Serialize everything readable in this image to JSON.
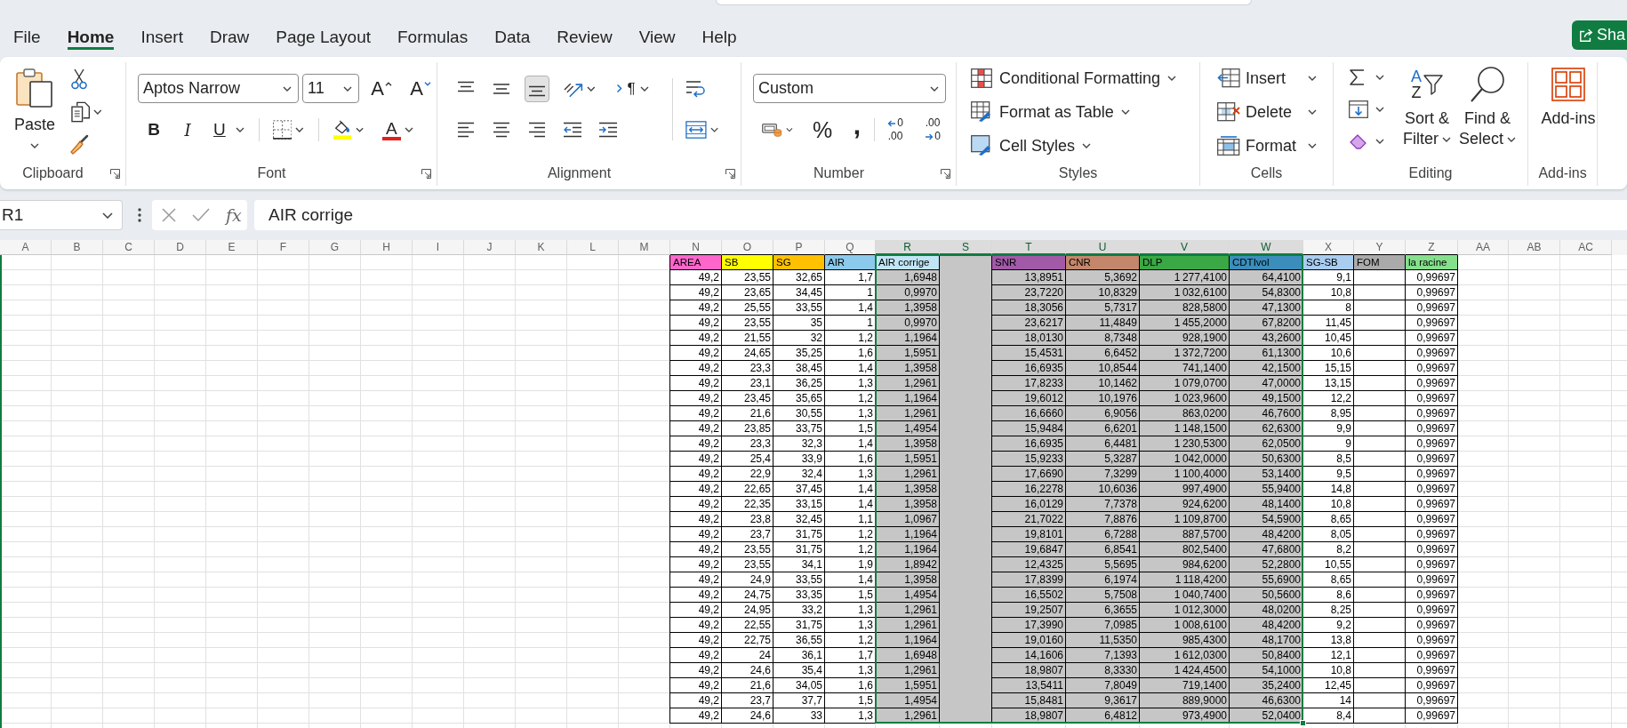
{
  "menu_tabs": [
    {
      "label": "File",
      "selected": false
    },
    {
      "label": "Home",
      "selected": true
    },
    {
      "label": "Insert",
      "selected": false
    },
    {
      "label": "Draw",
      "selected": false
    },
    {
      "label": "Page Layout",
      "selected": false
    },
    {
      "label": "Formulas",
      "selected": false
    },
    {
      "label": "Data",
      "selected": false
    },
    {
      "label": "Review",
      "selected": false
    },
    {
      "label": "View",
      "selected": false
    },
    {
      "label": "Help",
      "selected": false
    }
  ],
  "share_button": {
    "label": "Sha"
  },
  "ribbon": {
    "clipboard": {
      "paste_label": "Paste",
      "group_label": "Clipboard"
    },
    "font": {
      "font_name": "Aptos Narrow",
      "font_size": "11",
      "grow_label": "A",
      "shrink_label": "A",
      "bold_label": "B",
      "italic_label": "I",
      "underline_label": "U",
      "font_color_label": "A",
      "group_label": "Font"
    },
    "alignment": {
      "vertical_align": [
        {
          "kind": "top",
          "selected": false
        },
        {
          "kind": "middle",
          "selected": false
        },
        {
          "kind": "bottom",
          "selected": true
        }
      ],
      "text_direction_label": "¶",
      "group_label": "Alignment"
    },
    "number": {
      "format": "Custom",
      "percent_label": "%",
      "comma_label": ",",
      "increase_decimal": [
        "0",
        ".00"
      ],
      "decrease_decimal": [
        ".00",
        "0"
      ],
      "group_label": "Number"
    },
    "styles": {
      "items": [
        {
          "label": "Conditional Formatting",
          "kind": "conditional"
        },
        {
          "label": "Format as Table",
          "kind": "table"
        },
        {
          "label": "Cell Styles",
          "kind": "styles"
        }
      ],
      "group_label": "Styles"
    },
    "cells": {
      "items": [
        {
          "label": "Insert",
          "kind": "insert"
        },
        {
          "label": "Delete",
          "kind": "delete"
        },
        {
          "label": "Format",
          "kind": "format"
        }
      ],
      "group_label": "Cells"
    },
    "editing": {
      "sort_letters": [
        "A",
        "Z"
      ],
      "sort_label": "Sort & Filter",
      "find_label": "Find & Select",
      "group_label": "Editing"
    },
    "add_ins": {
      "button_label": "Add-ins",
      "group_label": "Add-ins"
    }
  },
  "formula_bar": {
    "name_box": "R1",
    "fx_label": "fx",
    "content": "AIR corrige"
  },
  "sheet": {
    "columns": [
      {
        "letter": "A",
        "selected": false
      },
      {
        "letter": "B",
        "selected": false
      },
      {
        "letter": "C",
        "selected": false
      },
      {
        "letter": "D",
        "selected": false
      },
      {
        "letter": "E",
        "selected": false
      },
      {
        "letter": "F",
        "selected": false
      },
      {
        "letter": "G",
        "selected": false
      },
      {
        "letter": "H",
        "selected": false
      },
      {
        "letter": "I",
        "selected": false
      },
      {
        "letter": "J",
        "selected": false
      },
      {
        "letter": "K",
        "selected": false
      },
      {
        "letter": "L",
        "selected": false
      },
      {
        "letter": "M",
        "selected": false
      },
      {
        "letter": "N",
        "selected": false,
        "header": {
          "label": "AREA",
          "color": "#ff66cc"
        },
        "cells": [
          "49,2",
          "49,2",
          "49,2",
          "49,2",
          "49,2",
          "49,2",
          "49,2",
          "49,2",
          "49,2",
          "49,2",
          "49,2",
          "49,2",
          "49,2",
          "49,2",
          "49,2",
          "49,2",
          "49,2",
          "49,2",
          "49,2",
          "49,2",
          "49,2",
          "49,2",
          "49,2",
          "49,2",
          "49,2",
          "49,2",
          "49,2",
          "49,2",
          "49,2",
          "49,2"
        ]
      },
      {
        "letter": "O",
        "selected": false,
        "header": {
          "label": "SB",
          "color": "#ffff00"
        },
        "cells": [
          "23,55",
          "23,65",
          "25,55",
          "23,55",
          "21,55",
          "24,65",
          "23,3",
          "23,1",
          "23,45",
          "21,6",
          "23,85",
          "23,3",
          "25,4",
          "22,9",
          "22,65",
          "22,35",
          "23,8",
          "23,7",
          "23,55",
          "23,55",
          "24,9",
          "24,75",
          "24,95",
          "22,55",
          "22,75",
          "24",
          "24,6",
          "21,6",
          "23,7",
          "24,6"
        ]
      },
      {
        "letter": "P",
        "selected": false,
        "header": {
          "label": "SG",
          "color": "#ffc000"
        },
        "cells": [
          "32,65",
          "34,45",
          "33,55",
          "35",
          "32",
          "35,25",
          "38,45",
          "36,25",
          "35,65",
          "30,55",
          "33,75",
          "32,3",
          "33,9",
          "32,4",
          "37,45",
          "33,15",
          "32,45",
          "31,75",
          "31,75",
          "34,1",
          "33,55",
          "33,35",
          "33,2",
          "31,75",
          "36,55",
          "36,1",
          "35,4",
          "34,05",
          "37,7",
          "33"
        ]
      },
      {
        "letter": "Q",
        "selected": false,
        "header": {
          "label": "AIR",
          "color": "#8ccaec"
        },
        "cells": [
          "1,7",
          "1",
          "1,4",
          "1",
          "1,2",
          "1,6",
          "1,4",
          "1,3",
          "1,2",
          "1,3",
          "1,5",
          "1,4",
          "1,6",
          "1,3",
          "1,4",
          "1,4",
          "1,1",
          "1,2",
          "1,2",
          "1,9",
          "1,4",
          "1,5",
          "1,3",
          "1,3",
          "1,2",
          "1,7",
          "1,3",
          "1,6",
          "1,5",
          "1,3"
        ]
      },
      {
        "letter": "R",
        "selected": true,
        "header": {
          "label": "AIR corrige",
          "color": "#c1e5f5"
        },
        "cells": [
          "1,6948",
          "0,9970",
          "1,3958",
          "0,9970",
          "1,1964",
          "1,5951",
          "1,3958",
          "1,2961",
          "1,1964",
          "1,2961",
          "1,4954",
          "1,3958",
          "1,5951",
          "1,2961",
          "1,3958",
          "1,3958",
          "1,0967",
          "1,1964",
          "1,1964",
          "1,8942",
          "1,3958",
          "1,4954",
          "1,2961",
          "1,2961",
          "1,1964",
          "1,6948",
          "1,2961",
          "1,5951",
          "1,4954",
          "1,2961"
        ]
      },
      {
        "letter": "S",
        "selected": true
      },
      {
        "letter": "T",
        "selected": true,
        "header": {
          "label": "SNR",
          "color": "#a25aa8"
        },
        "cells": [
          "13,8951",
          "23,7220",
          "18,3056",
          "23,6217",
          "18,0130",
          "15,4531",
          "16,6935",
          "17,8233",
          "19,6012",
          "16,6660",
          "15,9484",
          "16,6935",
          "15,9233",
          "17,6690",
          "16,2278",
          "16,0129",
          "21,7022",
          "19,8101",
          "19,6847",
          "12,4325",
          "17,8399",
          "16,5502",
          "19,2507",
          "17,3990",
          "19,0160",
          "14,1606",
          "18,9807",
          "13,5411",
          "15,8481",
          "18,9807"
        ]
      },
      {
        "letter": "U",
        "selected": true,
        "header": {
          "label": "CNR",
          "color": "#c4876c"
        },
        "cells": [
          "5,3692",
          "10,8329",
          "5,7317",
          "11,4849",
          "8,7348",
          "6,6452",
          "10,8544",
          "10,1462",
          "10,1976",
          "6,9056",
          "6,6201",
          "6,4481",
          "5,3287",
          "7,3299",
          "10,6036",
          "7,7378",
          "7,8876",
          "6,7288",
          "6,8541",
          "5,5695",
          "6,1974",
          "5,7508",
          "6,3655",
          "7,0985",
          "11,5350",
          "7,1393",
          "8,3330",
          "7,8049",
          "9,3617",
          "6,4812"
        ]
      },
      {
        "letter": "V",
        "selected": true,
        "header": {
          "label": "DLP",
          "color": "#3aa845"
        },
        "cells": [
          "1 277,4100",
          "1 032,6100",
          "828,5800",
          "1 455,2000",
          "928,1900",
          "1 372,7200",
          "741,1400",
          "1 079,0700",
          "1 023,9600",
          "863,0200",
          "1 148,1500",
          "1 230,5300",
          "1 042,0000",
          "1 100,4000",
          "997,4900",
          "924,6200",
          "1 109,8700",
          "887,5700",
          "802,5400",
          "984,6200",
          "1 118,4200",
          "1 040,7400",
          "1 012,3000",
          "1 008,6100",
          "985,4300",
          "1 612,0300",
          "1 424,4500",
          "719,1400",
          "889,9000",
          "973,4900"
        ]
      },
      {
        "letter": "W",
        "selected": true,
        "header": {
          "label": "CDTIvol",
          "color": "#3b8ebb"
        },
        "cells": [
          "64,4100",
          "54,8300",
          "47,1300",
          "67,8200",
          "43,2600",
          "61,1300",
          "42,1500",
          "47,0000",
          "49,1500",
          "46,7600",
          "62,6300",
          "62,0500",
          "50,6300",
          "53,1400",
          "55,9400",
          "48,1400",
          "54,5900",
          "48,4200",
          "47,6800",
          "52,2800",
          "55,6900",
          "50,5600",
          "48,0200",
          "48,4200",
          "48,1700",
          "50,8400",
          "54,1000",
          "35,2400",
          "46,6300",
          "52,0400"
        ]
      },
      {
        "letter": "X",
        "selected": false,
        "header": {
          "label": "SG-SB",
          "color": "#a9cdf0"
        },
        "cells": [
          "9,1",
          "10,8",
          "8",
          "11,45",
          "10,45",
          "10,6",
          "15,15",
          "13,15",
          "12,2",
          "8,95",
          "9,9",
          "9",
          "8,5",
          "9,5",
          "14,8",
          "10,8",
          "8,65",
          "8,05",
          "8,2",
          "10,55",
          "8,65",
          "8,6",
          "8,25",
          "9,2",
          "13,8",
          "12,1",
          "10,8",
          "12,45",
          "14",
          "8,4"
        ]
      },
      {
        "letter": "Y",
        "selected": false,
        "header": {
          "label": "FOM",
          "color": "#aaaaaa"
        }
      },
      {
        "letter": "Z",
        "selected": false,
        "header": {
          "label": "la racine",
          "color": "#85e08c"
        },
        "cells": [
          "0,99697",
          "0,99697",
          "0,99697",
          "0,99697",
          "0,99697",
          "0,99697",
          "0,99697",
          "0,99697",
          "0,99697",
          "0,99697",
          "0,99697",
          "0,99697",
          "0,99697",
          "0,99697",
          "0,99697",
          "0,99697",
          "0,99697",
          "0,99697",
          "0,99697",
          "0,99697",
          "0,99697",
          "0,99697",
          "0,99697",
          "0,99697",
          "0,99697",
          "0,99697",
          "0,99697",
          "0,99697",
          "0,99697",
          "0,99697"
        ]
      },
      {
        "letter": "AA",
        "selected": false
      },
      {
        "letter": "AB",
        "selected": false
      },
      {
        "letter": "AC",
        "selected": false
      }
    ]
  }
}
